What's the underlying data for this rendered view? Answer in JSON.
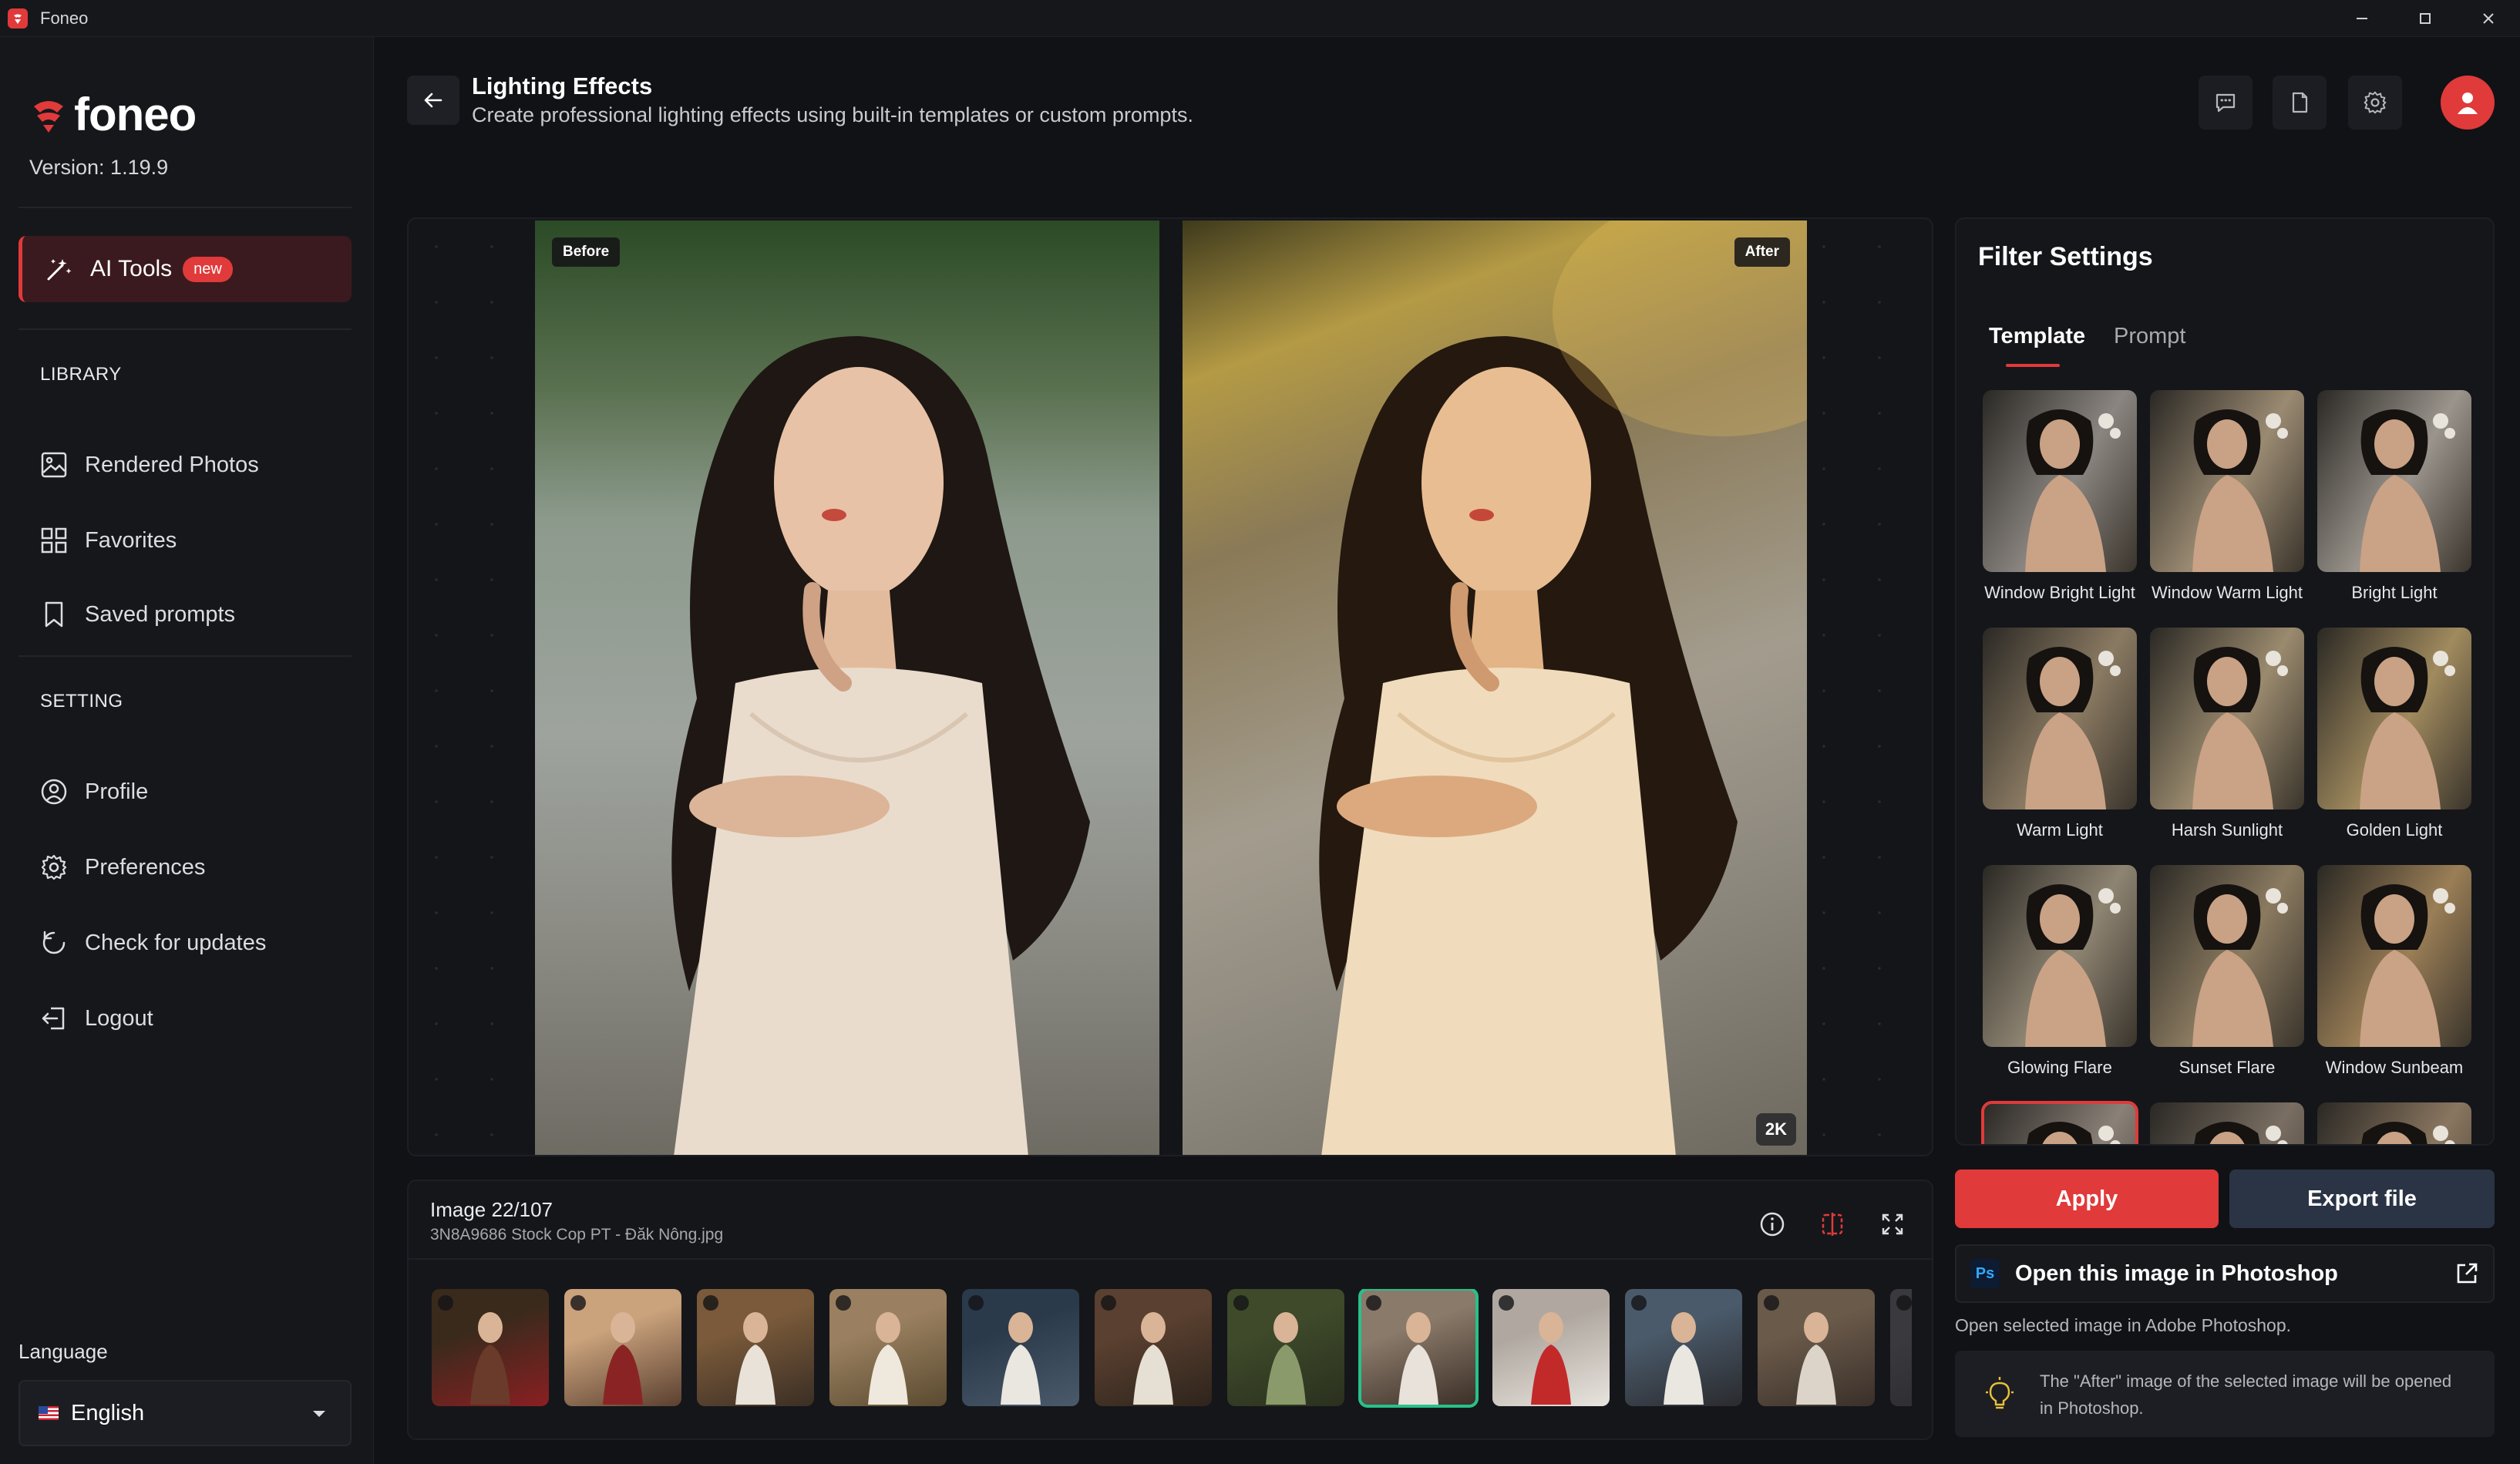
{
  "window": {
    "app_name": "Foneo"
  },
  "sidebar": {
    "logo_text": "foneo",
    "version": "Version: 1.19.9",
    "ai_tools": {
      "label": "AI Tools",
      "badge": "new"
    },
    "library_heading": "LIBRARY",
    "library_items": [
      {
        "label": "Rendered Photos",
        "icon": "image-icon"
      },
      {
        "label": "Favorites",
        "icon": "grid-icon"
      },
      {
        "label": "Saved prompts",
        "icon": "bookmark-icon"
      }
    ],
    "setting_heading": "SETTING",
    "setting_items": [
      {
        "label": "Profile",
        "icon": "user-circle-icon"
      },
      {
        "label": "Preferences",
        "icon": "gear-icon"
      },
      {
        "label": "Check for updates",
        "icon": "refresh-icon"
      },
      {
        "label": "Logout",
        "icon": "logout-icon"
      }
    ],
    "language_label": "Language",
    "language_value": "English"
  },
  "header": {
    "title": "Lighting Effects",
    "subtitle": "Create professional lighting effects using built-in templates or custom prompts."
  },
  "compare": {
    "before_label": "Before",
    "after_label": "After",
    "resolution_badge": "2K"
  },
  "image_info": {
    "count": "Image 22/107",
    "filename": "3N8A9686 Stock Cop PT - Đăk Nông.jpg",
    "thumbnails": [
      {
        "colors": [
          "#3a2a1c",
          "#6a3b2a",
          "#8a1f22"
        ]
      },
      {
        "colors": [
          "#caa27c",
          "#8a2424",
          "#5a4030"
        ]
      },
      {
        "colors": [
          "#7a5a3a",
          "#e8e2d8",
          "#3a2e24"
        ]
      },
      {
        "colors": [
          "#9a8060",
          "#efe8dc",
          "#5a4a30"
        ]
      },
      {
        "colors": [
          "#2a3a4a",
          "#eae6e0",
          "#4a5a6a"
        ]
      },
      {
        "colors": [
          "#5a4030",
          "#e6dfd4",
          "#2e241c"
        ]
      },
      {
        "colors": [
          "#3e4a2a",
          "#8a9a6a",
          "#2a301e"
        ]
      },
      {
        "colors": [
          "#8a7a6a",
          "#e8e2da",
          "#3a2e26"
        ]
      },
      {
        "colors": [
          "#b0a8a0",
          "#c22a2a",
          "#e8e4de"
        ]
      },
      {
        "colors": [
          "#4a5a6a",
          "#eae6e0",
          "#2a2a2e"
        ]
      },
      {
        "colors": [
          "#6a5a4a",
          "#dcd4c8",
          "#3a302a"
        ]
      },
      {
        "colors": [
          "#3a3a3e",
          "#8a8a8e",
          "#2a2a2e"
        ]
      }
    ],
    "selected_index": 7
  },
  "filter_settings": {
    "title": "Filter Settings",
    "tabs": [
      {
        "label": "Template"
      },
      {
        "label": "Prompt"
      }
    ],
    "templates": [
      {
        "name": "Window Bright Light",
        "tone": "#8a8580"
      },
      {
        "name": "Window Warm Light",
        "tone": "#9a8a72"
      },
      {
        "name": "Bright Light",
        "tone": "#9a948c"
      },
      {
        "name": "Warm Light",
        "tone": "#8a7a62"
      },
      {
        "name": "Harsh Sunlight",
        "tone": "#9a8a6e"
      },
      {
        "name": "Golden Light",
        "tone": "#a08a5e"
      },
      {
        "name": "Glowing Flare",
        "tone": "#8e8472"
      },
      {
        "name": "Sunset Flare",
        "tone": "#8a7a60"
      },
      {
        "name": "Window Sunbeam",
        "tone": "#9a7e56"
      },
      {
        "name": "",
        "tone": "#8a8078"
      },
      {
        "name": "",
        "tone": "#7a6e62"
      },
      {
        "name": "",
        "tone": "#8a7660"
      }
    ],
    "selected_template_index": 9
  },
  "actions": {
    "apply": "Apply",
    "export": "Export file",
    "photoshop_label": "Open this image in Photoshop",
    "photoshop_logo": "Ps",
    "photoshop_desc": "Open selected image in Adobe Photoshop.",
    "tip": "The \"After\" image of the selected image will be opened in Photoshop."
  },
  "colors": {
    "accent": "#e03a3a",
    "selected_thumb": "#27c18a",
    "background": "#111216"
  }
}
